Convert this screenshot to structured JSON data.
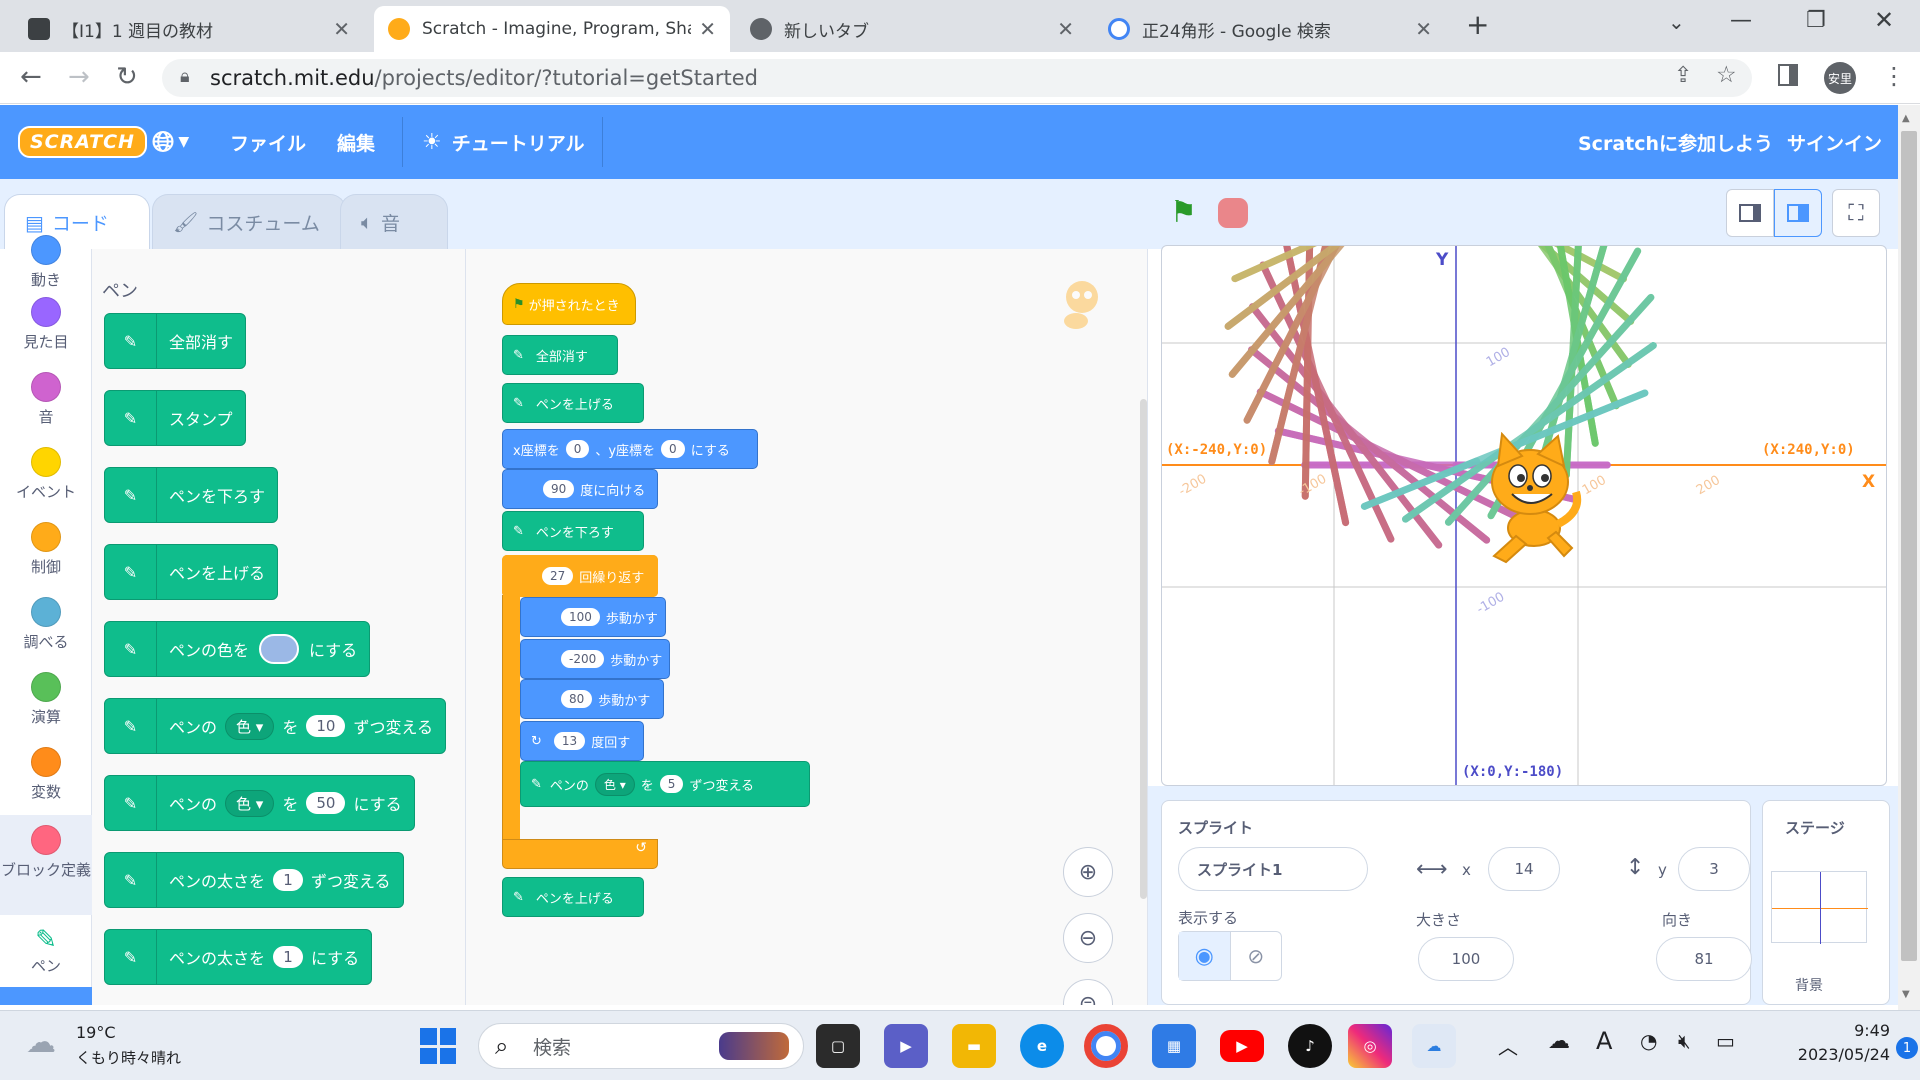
{
  "browser": {
    "tabs": [
      {
        "title": "【I1】1 週目の教材",
        "active": false
      },
      {
        "title": "Scratch - Imagine, Program, Shar",
        "active": true
      },
      {
        "title": "新しいタブ",
        "active": false
      },
      {
        "title": "正24角形 - Google 検索",
        "active": false
      }
    ],
    "url_domain": "scratch.mit.edu",
    "url_path": "/projects/editor/?tutorial=getStarted",
    "profile_label": "安里"
  },
  "scratch": {
    "logo_text": "SCRATCH",
    "menu": {
      "file": "ファイル",
      "edit": "編集",
      "tutorial": "チュートリアル",
      "join": "Scratchに参加しよう",
      "signin": "サインイン"
    },
    "editor_tabs": {
      "code": "コード",
      "costumes": "コスチューム",
      "sounds": "音"
    },
    "categories": [
      {
        "label": "動き",
        "color": "#4c97ff"
      },
      {
        "label": "見た目",
        "color": "#9966ff"
      },
      {
        "label": "音",
        "color": "#cf63cf"
      },
      {
        "label": "イベント",
        "color": "#ffd500"
      },
      {
        "label": "制御",
        "color": "#ffab19"
      },
      {
        "label": "調べる",
        "color": "#5cb1d6"
      },
      {
        "label": "演算",
        "color": "#59c059"
      },
      {
        "label": "変数",
        "color": "#ff8c1a"
      },
      {
        "label": "ブロック定義",
        "color": "#ff6680"
      },
      {
        "label": "ペン",
        "color": "#0fbd8c"
      }
    ],
    "palette": {
      "heading": "ペン",
      "blocks": {
        "clear": "全部消す",
        "stamp": "スタンプ",
        "pen_down": "ペンを下ろす",
        "pen_up": "ペンを上げる",
        "set_color_a": "ペンの色を",
        "set_color_b": "にする",
        "change_param_a": "ペンの",
        "change_param_dd": "色",
        "change_param_b": "を",
        "change_param_val": "10",
        "change_param_c": "ずつ変える",
        "set_param_a": "ペンの",
        "set_param_dd": "色",
        "set_param_b": "を",
        "set_param_val": "50",
        "set_param_c": "にする",
        "change_size_a": "ペンの太さを",
        "change_size_val": "1",
        "change_size_b": "ずつ変える",
        "set_size_a": "ペンの太さを",
        "set_size_val": "1",
        "set_size_b": "にする"
      },
      "pen_color_swatch": "#9bb8e6"
    },
    "script": {
      "hat": "が押されたとき",
      "clear": "全部消す",
      "pen_up1": "ペンを上げる",
      "goto_a": "x座標を",
      "goto_x": "0",
      "goto_b": "、y座標を",
      "goto_y": "0",
      "goto_c": "にする",
      "dir_val": "90",
      "dir_text": "度に向ける",
      "pen_down": "ペンを下ろす",
      "repeat_val": "27",
      "repeat_text": "回繰り返す",
      "move1_val": "100",
      "move1_text": "歩動かす",
      "move2_val": "-200",
      "move2_text": "歩動かす",
      "move3_val": "80",
      "move3_text": "歩動かす",
      "turn_val": "13",
      "turn_text": "度回す",
      "chg_a": "ペンの",
      "chg_dd": "色",
      "chg_b": "を",
      "chg_val": "5",
      "chg_c": "ずつ変える",
      "pen_up2": "ペンを上げる"
    },
    "stage": {
      "axis_y": "Y",
      "axis_x": "X",
      "left_label": "(X:-240,Y:0)",
      "right_label": "(X:240,Y:0)",
      "bottom_label": "(X:0,Y:-180)",
      "tick_100": "100",
      "tick_m100": "-100",
      "tick_200": "200",
      "tick_m200": "-200"
    },
    "sprite_info": {
      "heading": "スプライト",
      "name": "スプライト1",
      "x_label": "x",
      "x": "14",
      "y_label": "y",
      "y": "3",
      "show_label": "表示する",
      "size_label": "大きさ",
      "size": "100",
      "direction_label": "向き",
      "direction": "81"
    },
    "stage_panel": {
      "heading": "ステージ",
      "backdrop_label": "背景"
    }
  },
  "taskbar": {
    "weather_temp": "19°C",
    "weather_desc": "くもり時々晴れ",
    "search_placeholder": "検索",
    "time": "9:49",
    "date": "2023/05/24",
    "notif_count": "1"
  }
}
